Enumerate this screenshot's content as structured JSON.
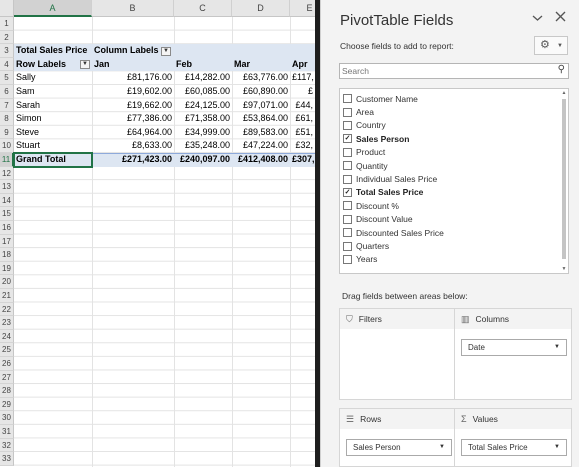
{
  "sheet": {
    "columns": [
      "A",
      "B",
      "C",
      "D",
      "E"
    ],
    "rows": [
      "1",
      "2",
      "3",
      "4",
      "5",
      "6",
      "7",
      "8",
      "9",
      "10",
      "11",
      "12",
      "13",
      "14",
      "15",
      "16",
      "17",
      "18",
      "19",
      "20",
      "21",
      "22",
      "23",
      "24",
      "25",
      "26",
      "27",
      "28",
      "29",
      "30",
      "31",
      "32",
      "33"
    ],
    "pivot": {
      "value_header": "Total Sales Price",
      "column_labels": "Column Labels",
      "row_labels": "Row Labels",
      "months": [
        "Jan",
        "Feb",
        "Mar",
        "Apr"
      ],
      "rows": [
        {
          "name": "Sally",
          "jan": "£81,176.00",
          "feb": "£14,282.00",
          "mar": "£63,776.00",
          "apr": "£117,"
        },
        {
          "name": "Sam",
          "jan": "£19,602.00",
          "feb": "£60,085.00",
          "mar": "£60,890.00",
          "apr": "£"
        },
        {
          "name": "Sarah",
          "jan": "£19,662.00",
          "feb": "£24,125.00",
          "mar": "£97,071.00",
          "apr": "£44,"
        },
        {
          "name": "Simon",
          "jan": "£77,386.00",
          "feb": "£71,358.00",
          "mar": "£53,864.00",
          "apr": "£61,"
        },
        {
          "name": "Steve",
          "jan": "£64,964.00",
          "feb": "£34,999.00",
          "mar": "£89,583.00",
          "apr": "£51,"
        },
        {
          "name": "Stuart",
          "jan": "£8,633.00",
          "feb": "£35,248.00",
          "mar": "£47,224.00",
          "apr": "£32,"
        }
      ],
      "grand_total": {
        "name": "Grand Total",
        "jan": "£271,423.00",
        "feb": "£240,097.00",
        "mar": "£412,408.00",
        "apr": "£307,"
      }
    }
  },
  "panel": {
    "title": "PivotTable Fields",
    "subtitle": "Choose fields to add to report:",
    "search_placeholder": "Search",
    "fields": [
      {
        "label": "Customer Name",
        "checked": false
      },
      {
        "label": "Area",
        "checked": false
      },
      {
        "label": "Country",
        "checked": false
      },
      {
        "label": "Sales Person",
        "checked": true
      },
      {
        "label": "Product",
        "checked": false
      },
      {
        "label": "Quantity",
        "checked": false
      },
      {
        "label": "Individual Sales Price",
        "checked": false
      },
      {
        "label": "Total Sales Price",
        "checked": true
      },
      {
        "label": "Discount %",
        "checked": false
      },
      {
        "label": "Discount Value",
        "checked": false
      },
      {
        "label": "Discounted Sales Price",
        "checked": false
      },
      {
        "label": "Quarters",
        "checked": false
      },
      {
        "label": "Years",
        "checked": false
      }
    ],
    "drag_label": "Drag fields between areas below:",
    "areas": {
      "filters": {
        "label": "Filters"
      },
      "columns": {
        "label": "Columns",
        "item": "Date"
      },
      "rows": {
        "label": "Rows",
        "item": "Sales Person"
      },
      "values": {
        "label": "Values",
        "item": "Total Sales Price"
      }
    },
    "icons": {
      "dropdown": "chevron-down-icon",
      "close": "close-icon",
      "gear": "gear-icon",
      "search": "search-icon"
    }
  },
  "colors": {
    "accent": "#217346",
    "pivot_band": "#dde6f2"
  }
}
